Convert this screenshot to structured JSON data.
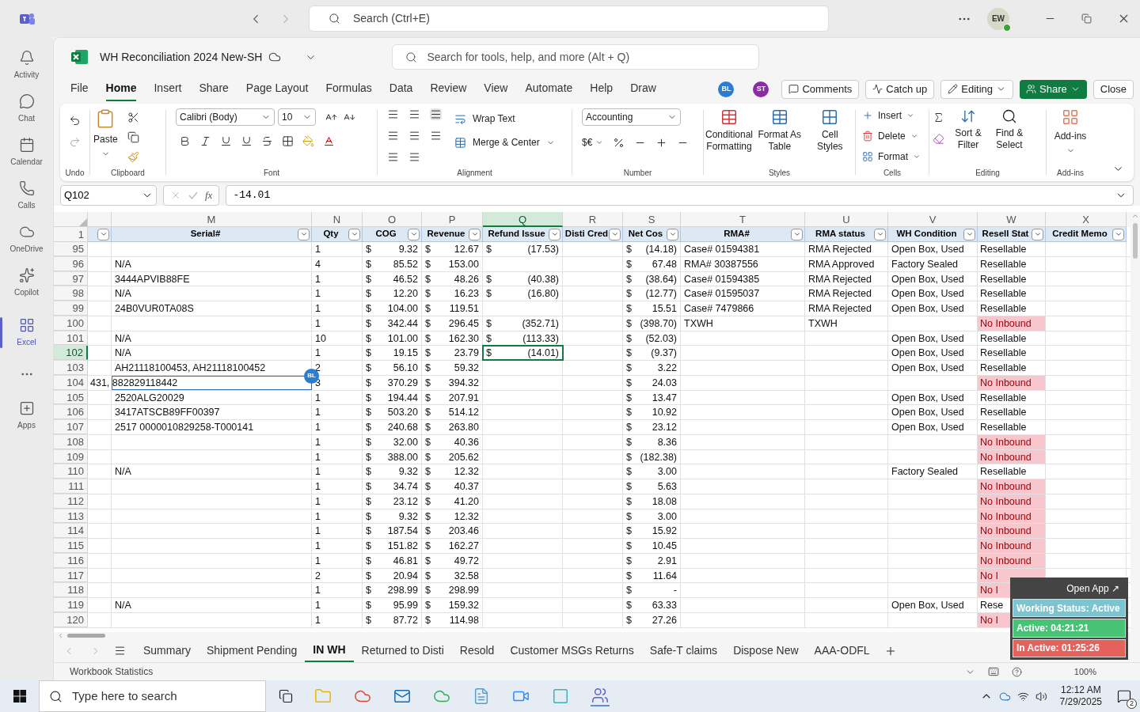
{
  "teams": {
    "search_placeholder": "Search (Ctrl+E)",
    "avatar": "EW"
  },
  "rail": [
    {
      "label": "Activity",
      "selected": false
    },
    {
      "label": "Chat",
      "selected": false
    },
    {
      "label": "Calendar",
      "selected": false
    },
    {
      "label": "Calls",
      "selected": false
    },
    {
      "label": "OneDrive",
      "selected": false
    },
    {
      "label": "Copilot",
      "selected": false
    },
    {
      "label": "Excel",
      "selected": true
    },
    {
      "label": "Apps",
      "selected": false
    }
  ],
  "excel": {
    "title": "WH Reconciliation 2024 New-SH",
    "search_placeholder": "Search for tools, help, and more (Alt + Q)",
    "menu": [
      {
        "label": "File",
        "selected": false
      },
      {
        "label": "Home",
        "selected": true
      },
      {
        "label": "Insert",
        "selected": false
      },
      {
        "label": "Share",
        "selected": false
      },
      {
        "label": "Page Layout",
        "selected": false
      },
      {
        "label": "Formulas",
        "selected": false
      },
      {
        "label": "Data",
        "selected": false
      },
      {
        "label": "Review",
        "selected": false
      },
      {
        "label": "View",
        "selected": false
      },
      {
        "label": "Automate",
        "selected": false
      },
      {
        "label": "Help",
        "selected": false
      },
      {
        "label": "Draw",
        "selected": false
      }
    ],
    "collaborators": [
      {
        "initials": "BL",
        "color": "#2b7cd3"
      },
      {
        "initials": "ST",
        "color": "#8a2da5"
      }
    ],
    "actions": [
      {
        "label": "Comments",
        "kind": "comments"
      },
      {
        "label": "Catch up",
        "kind": "catchup"
      },
      {
        "label": "Editing",
        "kind": "mode"
      },
      {
        "label": "Share",
        "kind": "share"
      },
      {
        "label": "Close",
        "kind": "plain"
      }
    ]
  },
  "ribbon": {
    "paste": "Paste",
    "font": "Calibri (Body)",
    "size": "10",
    "wrap_text": "Wrap Text",
    "merge": "Merge & Center",
    "number_format": "Accounting",
    "currency": "$€",
    "styles": [
      "Conditional Formatting",
      "Format As Table",
      "Cell Styles"
    ],
    "cells": [
      "Insert",
      "Delete",
      "Format"
    ],
    "editing": [
      "Sort & Filter",
      "Find & Select"
    ],
    "addins": "Add-ins",
    "groups": [
      "Undo",
      "Clipboard",
      "Font",
      "Alignment",
      "Number",
      "Styles",
      "Cells",
      "Editing",
      "Add-ins"
    ]
  },
  "formula_bar": {
    "name_box": "Q102",
    "function_label": "fx",
    "formula": "-14.01"
  },
  "sheet": {
    "header_row": "1",
    "columns": [
      {
        "selected": false
      },
      {
        "letter": "M",
        "header": "Serial#",
        "selected": false
      },
      {
        "letter": "N",
        "header": "Qty",
        "selected": false
      },
      {
        "letter": "O",
        "header": "COG",
        "selected": false
      },
      {
        "letter": "P",
        "header": "Revenue",
        "selected": false
      },
      {
        "letter": "Q",
        "header": "Refund Issue",
        "selected": true
      },
      {
        "letter": "R",
        "header": "Disti Cred",
        "selected": false
      },
      {
        "letter": "S",
        "header": "Net Cos",
        "selected": false
      },
      {
        "letter": "T",
        "header": "RMA#",
        "selected": false
      },
      {
        "letter": "U",
        "header": "RMA status",
        "selected": false
      },
      {
        "letter": "V",
        "header": "WH Condition",
        "selected": false
      },
      {
        "letter": "W",
        "header": "Resell Stat",
        "selected": false
      },
      {
        "letter": "X",
        "header": "Credit Memo",
        "selected": false
      }
    ],
    "rows": [
      {
        "number": "95",
        "selected": false,
        "cells": [
          null,
          null,
          "1",
          [
            "$",
            "9.32"
          ],
          [
            "$",
            "12.67"
          ],
          [
            "$",
            "(17.53)"
          ],
          null,
          [
            "$",
            "(14.18)"
          ],
          "Case# 01594381",
          "RMA Rejected",
          "Open Box, Used",
          {
            "text": "Resellable",
            "highlighted": false
          },
          null
        ]
      },
      {
        "number": "96",
        "selected": false,
        "cells": [
          null,
          "N/A",
          "4",
          [
            "$",
            "85.52"
          ],
          [
            "$",
            "153.00"
          ],
          null,
          null,
          [
            "$",
            "67.48"
          ],
          "RMA# 30387556",
          "RMA Approved",
          "Factory Sealed",
          {
            "text": "Resellable",
            "highlighted": false
          },
          null
        ]
      },
      {
        "number": "97",
        "selected": false,
        "cells": [
          null,
          "3444APVIB88FE",
          "1",
          [
            "$",
            "46.52"
          ],
          [
            "$",
            "48.26"
          ],
          [
            "$",
            "(40.38)"
          ],
          null,
          [
            "$",
            "(38.64)"
          ],
          "Case# 01594385",
          "RMA Rejected",
          "Open Box, Used",
          {
            "text": "Resellable",
            "highlighted": false
          },
          null
        ]
      },
      {
        "number": "98",
        "selected": false,
        "cells": [
          null,
          "N/A",
          "1",
          [
            "$",
            "12.20"
          ],
          [
            "$",
            "16.23"
          ],
          [
            "$",
            "(16.80)"
          ],
          null,
          [
            "$",
            "(12.77)"
          ],
          "Case# 01595037",
          "RMA Rejected",
          "Open Box, Used",
          {
            "text": "Resellable",
            "highlighted": false
          },
          null
        ]
      },
      {
        "number": "99",
        "selected": false,
        "cells": [
          null,
          "24B0VUR0TA08S",
          "1",
          [
            "$",
            "104.00"
          ],
          [
            "$",
            "119.51"
          ],
          null,
          null,
          [
            "$",
            "15.51"
          ],
          "Case# 7479866",
          "RMA Rejected",
          "Open Box, Used",
          {
            "text": "Resellable",
            "highlighted": false
          },
          null
        ]
      },
      {
        "number": "100",
        "selected": false,
        "cells": [
          null,
          null,
          "1",
          [
            "$",
            "342.44"
          ],
          [
            "$",
            "296.45"
          ],
          [
            "$",
            "(352.71)"
          ],
          null,
          [
            "$",
            "(398.70)"
          ],
          "TXWH",
          "TXWH",
          null,
          {
            "text": "No Inbound",
            "highlighted": true
          },
          null
        ]
      },
      {
        "number": "101",
        "selected": false,
        "cells": [
          null,
          "N/A",
          "10",
          [
            "$",
            "101.00"
          ],
          [
            "$",
            "162.30"
          ],
          [
            "$",
            "(113.33)"
          ],
          null,
          [
            "$",
            "(52.03)"
          ],
          null,
          null,
          "Open Box, Used",
          {
            "text": "Resellable",
            "highlighted": false
          },
          null
        ]
      },
      {
        "number": "102",
        "selected": true,
        "cells": [
          null,
          "N/A",
          "1",
          [
            "$",
            "19.15"
          ],
          [
            "$",
            "23.79"
          ],
          [
            "$",
            "(14.01)"
          ],
          null,
          [
            "$",
            "(9.37)"
          ],
          null,
          null,
          "Open Box, Used",
          {
            "text": "Resellable",
            "highlighted": false
          },
          null
        ]
      },
      {
        "number": "103",
        "selected": false,
        "cells": [
          null,
          "AH21118100453, AH21118100452",
          "2",
          [
            "$",
            "56.10"
          ],
          [
            "$",
            "59.32"
          ],
          null,
          null,
          [
            "$",
            "3.22"
          ],
          null,
          null,
          "Open Box, Used",
          {
            "text": "Resellable",
            "highlighted": false
          },
          null
        ]
      },
      {
        "number": "104",
        "selected": false,
        "overflow_left": true,
        "collaborator": "BL",
        "cells": [
          null,
          "431, 882829118442",
          "3",
          [
            "$",
            "370.29"
          ],
          [
            "$",
            "394.32"
          ],
          null,
          null,
          [
            "$",
            "24.03"
          ],
          null,
          null,
          null,
          {
            "text": "No Inbound",
            "highlighted": true
          },
          null
        ]
      },
      {
        "number": "105",
        "selected": false,
        "cells": [
          null,
          "2520ALG20029",
          "1",
          [
            "$",
            "194.44"
          ],
          [
            "$",
            "207.91"
          ],
          null,
          null,
          [
            "$",
            "13.47"
          ],
          null,
          null,
          "Open Box, Used",
          {
            "text": "Resellable",
            "highlighted": false
          },
          null
        ]
      },
      {
        "number": "106",
        "selected": false,
        "cells": [
          null,
          "3417ATSCB89FF00397",
          "1",
          [
            "$",
            "503.20"
          ],
          [
            "$",
            "514.12"
          ],
          null,
          null,
          [
            "$",
            "10.92"
          ],
          null,
          null,
          "Open Box, Used",
          {
            "text": "Resellable",
            "highlighted": false
          },
          null
        ]
      },
      {
        "number": "107",
        "selected": false,
        "cells": [
          null,
          "2517 0000010829258-T000141",
          "1",
          [
            "$",
            "240.68"
          ],
          [
            "$",
            "263.80"
          ],
          null,
          null,
          [
            "$",
            "23.12"
          ],
          null,
          null,
          "Open Box, Used",
          {
            "text": "Resellable",
            "highlighted": false
          },
          null
        ]
      },
      {
        "number": "108",
        "selected": false,
        "cells": [
          null,
          null,
          "1",
          [
            "$",
            "32.00"
          ],
          [
            "$",
            "40.36"
          ],
          null,
          null,
          [
            "$",
            "8.36"
          ],
          null,
          null,
          null,
          {
            "text": "No Inbound",
            "highlighted": true
          },
          null
        ]
      },
      {
        "number": "109",
        "selected": false,
        "cells": [
          null,
          null,
          "1",
          [
            "$",
            "388.00"
          ],
          [
            "$",
            "205.62"
          ],
          null,
          null,
          [
            "$",
            "(182.38)"
          ],
          null,
          null,
          null,
          {
            "text": "No Inbound",
            "highlighted": true
          },
          null
        ]
      },
      {
        "number": "110",
        "selected": false,
        "cells": [
          null,
          "N/A",
          "1",
          [
            "$",
            "9.32"
          ],
          [
            "$",
            "12.32"
          ],
          null,
          null,
          [
            "$",
            "3.00"
          ],
          null,
          null,
          "Factory Sealed",
          {
            "text": "Resellable",
            "highlighted": false
          },
          null
        ]
      },
      {
        "number": "111",
        "selected": false,
        "cells": [
          null,
          null,
          "1",
          [
            "$",
            "34.74"
          ],
          [
            "$",
            "40.37"
          ],
          null,
          null,
          [
            "$",
            "5.63"
          ],
          null,
          null,
          null,
          {
            "text": "No Inbound",
            "highlighted": true
          },
          null
        ]
      },
      {
        "number": "112",
        "selected": false,
        "cells": [
          null,
          null,
          "1",
          [
            "$",
            "23.12"
          ],
          [
            "$",
            "41.20"
          ],
          null,
          null,
          [
            "$",
            "18.08"
          ],
          null,
          null,
          null,
          {
            "text": "No Inbound",
            "highlighted": true
          },
          null
        ]
      },
      {
        "number": "113",
        "selected": false,
        "cells": [
          null,
          null,
          "1",
          [
            "$",
            "9.32"
          ],
          [
            "$",
            "12.32"
          ],
          null,
          null,
          [
            "$",
            "3.00"
          ],
          null,
          null,
          null,
          {
            "text": "No Inbound",
            "highlighted": true
          },
          null
        ]
      },
      {
        "number": "114",
        "selected": false,
        "cells": [
          null,
          null,
          "1",
          [
            "$",
            "187.54"
          ],
          [
            "$",
            "203.46"
          ],
          null,
          null,
          [
            "$",
            "15.92"
          ],
          null,
          null,
          null,
          {
            "text": "No Inbound",
            "highlighted": true
          },
          null
        ]
      },
      {
        "number": "115",
        "selected": false,
        "cells": [
          null,
          null,
          "1",
          [
            "$",
            "151.82"
          ],
          [
            "$",
            "162.27"
          ],
          null,
          null,
          [
            "$",
            "10.45"
          ],
          null,
          null,
          null,
          {
            "text": "No Inbound",
            "highlighted": true
          },
          null
        ]
      },
      {
        "number": "116",
        "selected": false,
        "cells": [
          null,
          null,
          "1",
          [
            "$",
            "46.81"
          ],
          [
            "$",
            "49.72"
          ],
          null,
          null,
          [
            "$",
            "2.91"
          ],
          null,
          null,
          null,
          {
            "text": "No Inbound",
            "highlighted": true
          },
          null
        ]
      },
      {
        "number": "117",
        "selected": false,
        "cells": [
          null,
          null,
          "2",
          [
            "$",
            "20.94"
          ],
          [
            "$",
            "32.58"
          ],
          null,
          null,
          [
            "$",
            "11.64"
          ],
          null,
          null,
          null,
          {
            "text": "No I",
            "highlighted": true
          },
          null
        ]
      },
      {
        "number": "118",
        "selected": false,
        "cells": [
          null,
          null,
          "1",
          [
            "$",
            "298.99"
          ],
          [
            "$",
            "298.99"
          ],
          null,
          null,
          [
            "$",
            "-"
          ],
          null,
          null,
          null,
          {
            "text": "No I",
            "highlighted": true
          },
          null
        ]
      },
      {
        "number": "119",
        "selected": false,
        "cells": [
          null,
          "N/A",
          "1",
          [
            "$",
            "95.99"
          ],
          [
            "$",
            "159.32"
          ],
          null,
          null,
          [
            "$",
            "63.33"
          ],
          null,
          null,
          "Open Box, Used",
          {
            "text": "Rese",
            "highlighted": false
          },
          null
        ]
      },
      {
        "number": "120",
        "selected": false,
        "cells": [
          null,
          null,
          "1",
          [
            "$",
            "87.72"
          ],
          [
            "$",
            "114.98"
          ],
          null,
          null,
          [
            "$",
            "27.26"
          ],
          null,
          null,
          null,
          {
            "text": "No I",
            "highlighted": true
          },
          null
        ]
      }
    ]
  },
  "sheet_tabs": [
    {
      "label": "Summary",
      "selected": false
    },
    {
      "label": "Shipment Pending",
      "selected": false
    },
    {
      "label": "IN WH",
      "selected": true
    },
    {
      "label": "Returned to Disti",
      "selected": false
    },
    {
      "label": "Resold",
      "selected": false
    },
    {
      "label": "Customer MSGs Returns",
      "selected": false
    },
    {
      "label": "Safe-T claims",
      "selected": false
    },
    {
      "label": "Dispose New",
      "selected": false
    },
    {
      "label": "AAA-ODFL",
      "selected": false
    }
  ],
  "status_bar": {
    "text": "Workbook Statistics",
    "zoom": "100%"
  },
  "timer_widget": {
    "open_app": "Open App ↗",
    "status": "Working Status: Active",
    "active": "Active: 04:21:21",
    "inactive": "In Active: 01:25:26"
  },
  "taskbar": {
    "search_placeholder": "Type here to search",
    "time": "12:12 AM",
    "date": "7/29/2025",
    "notifications": "2"
  }
}
